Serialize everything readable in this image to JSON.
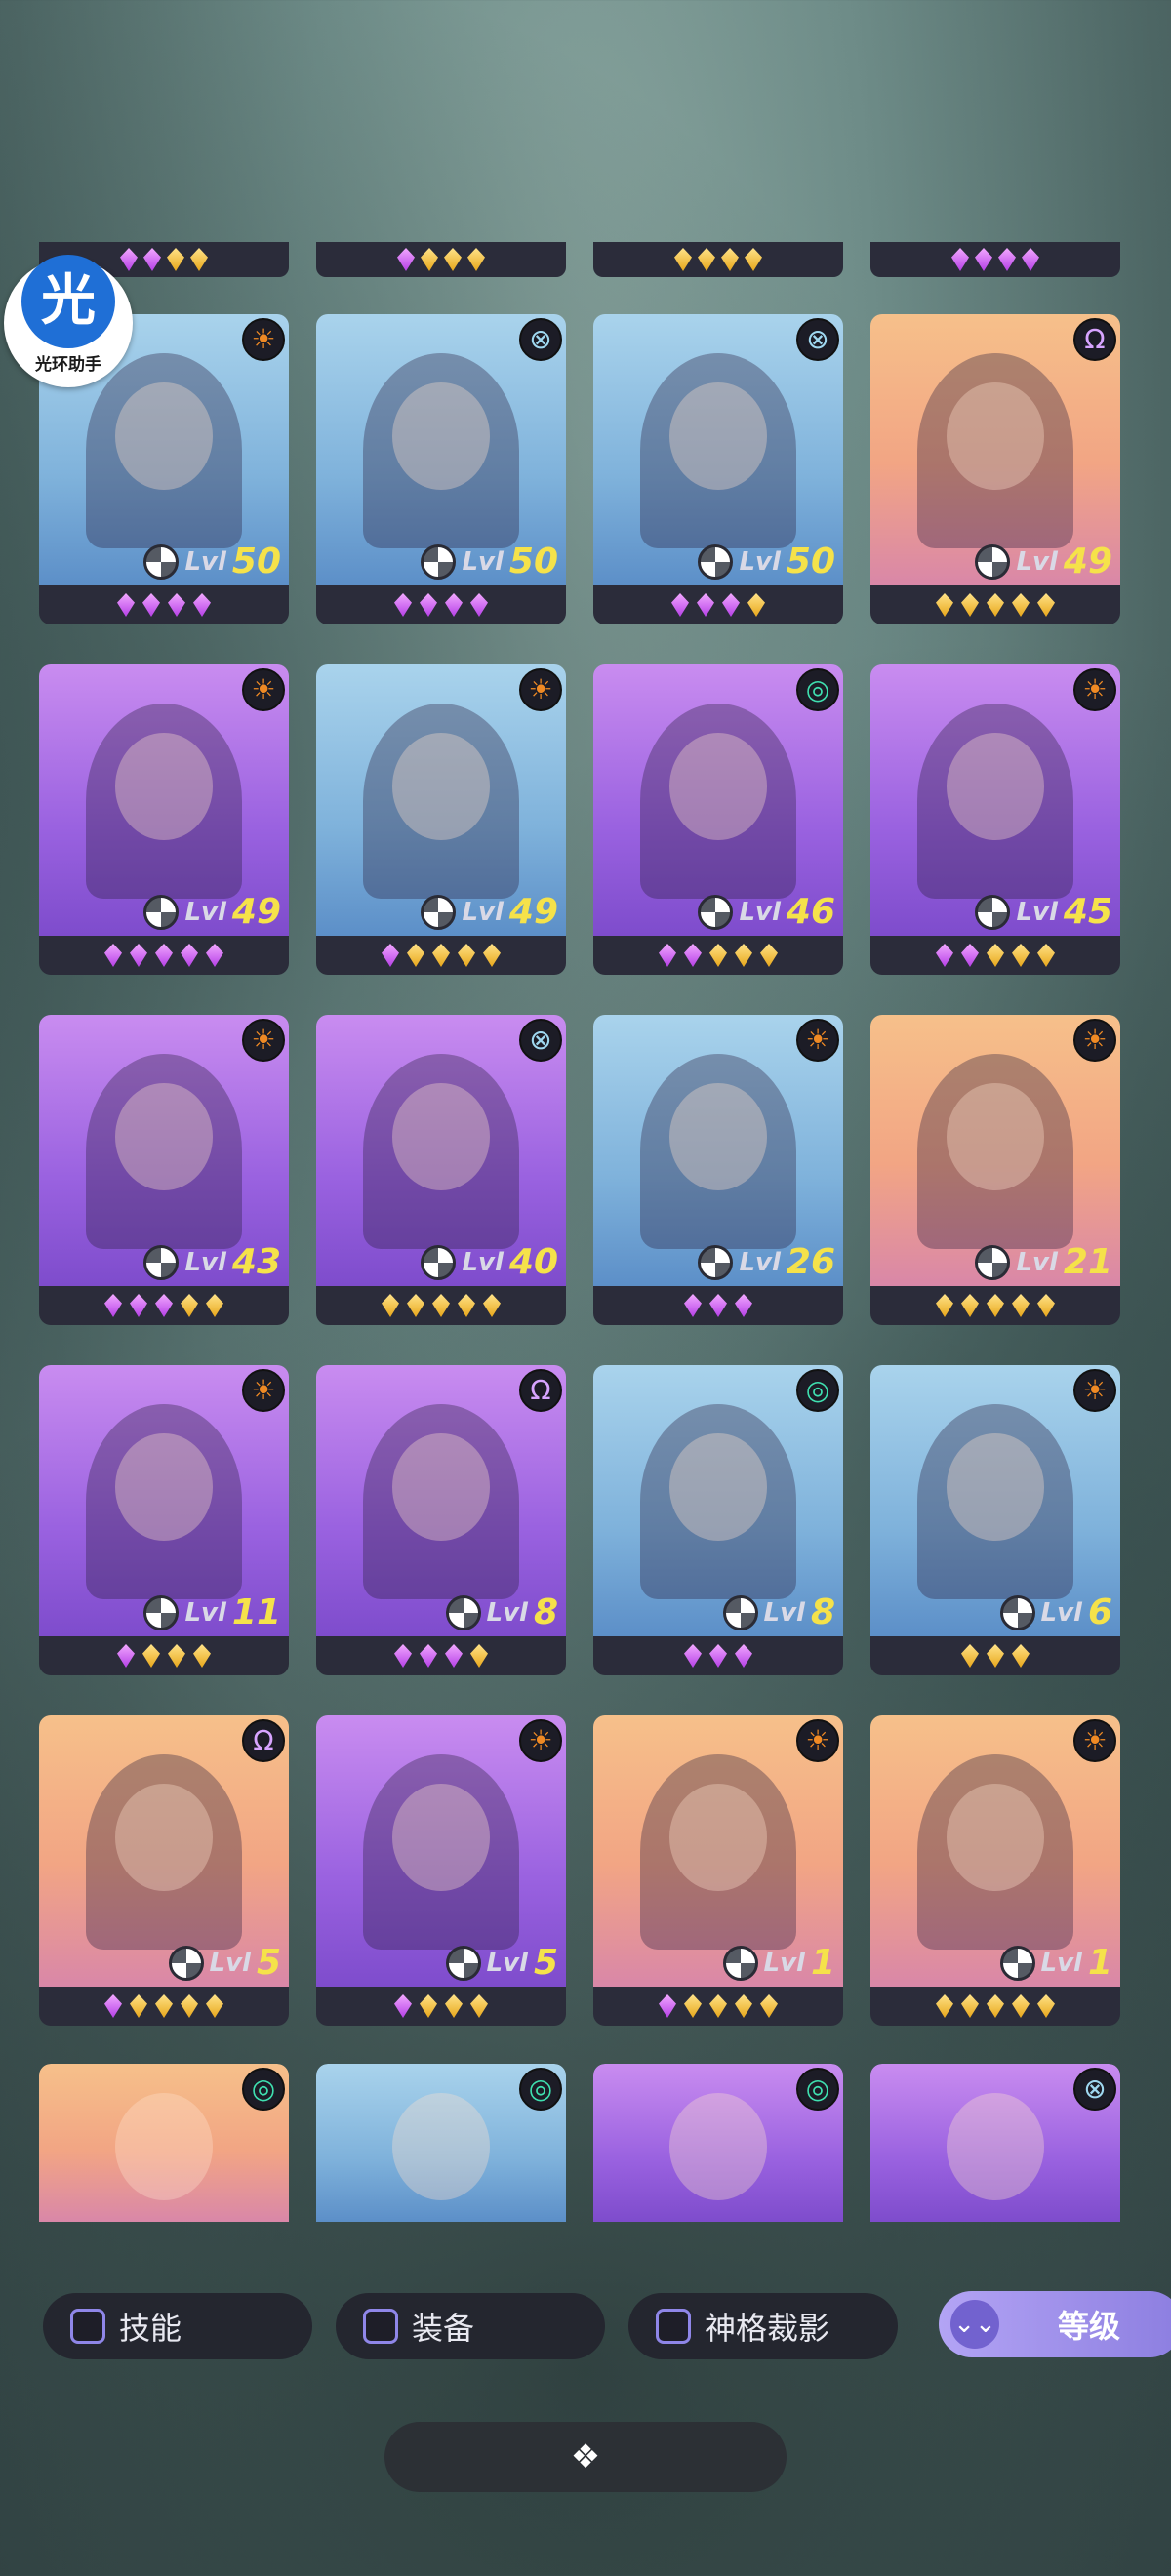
{
  "watermark": {
    "glyph": "光",
    "caption": "光环助手"
  },
  "faction_icons": {
    "sun": "☀",
    "cross": "⊗",
    "omega": "Ω",
    "spiral": "◎"
  },
  "top_partial_gems": [
    [
      "p",
      "p",
      "g",
      "g"
    ],
    [
      "p",
      "g",
      "g",
      "g"
    ],
    [
      "g",
      "g",
      "g",
      "g"
    ],
    [
      "p",
      "p",
      "p",
      "p"
    ]
  ],
  "heroes": [
    {
      "level_label": "Lvl",
      "level": "50",
      "bg": "blue",
      "faction": "sun",
      "gems": [
        "p",
        "p",
        "p",
        "p"
      ]
    },
    {
      "level_label": "Lvl",
      "level": "50",
      "bg": "blue",
      "faction": "cross",
      "gems": [
        "p",
        "p",
        "p",
        "p"
      ]
    },
    {
      "level_label": "Lvl",
      "level": "50",
      "bg": "blue",
      "faction": "cross",
      "gems": [
        "p",
        "p",
        "p",
        "g"
      ]
    },
    {
      "level_label": "Lvl",
      "level": "49",
      "bg": "orange",
      "faction": "omega",
      "gems": [
        "g",
        "g",
        "g",
        "g",
        "g"
      ]
    },
    {
      "level_label": "Lvl",
      "level": "49",
      "bg": "purple",
      "faction": "sun",
      "gems": [
        "p",
        "p",
        "p",
        "p",
        "p"
      ]
    },
    {
      "level_label": "Lvl",
      "level": "49",
      "bg": "blue",
      "faction": "sun",
      "gems": [
        "p",
        "g",
        "g",
        "g",
        "g"
      ]
    },
    {
      "level_label": "Lvl",
      "level": "46",
      "bg": "purple",
      "faction": "spiral",
      "gems": [
        "p",
        "p",
        "g",
        "g",
        "g"
      ]
    },
    {
      "level_label": "Lvl",
      "level": "45",
      "bg": "purple",
      "faction": "sun",
      "gems": [
        "p",
        "p",
        "g",
        "g",
        "g"
      ]
    },
    {
      "level_label": "Lvl",
      "level": "43",
      "bg": "purple",
      "faction": "sun",
      "gems": [
        "p",
        "p",
        "p",
        "g",
        "g"
      ]
    },
    {
      "level_label": "Lvl",
      "level": "40",
      "bg": "purple",
      "faction": "cross",
      "gems": [
        "g",
        "g",
        "g",
        "g",
        "g"
      ]
    },
    {
      "level_label": "Lvl",
      "level": "26",
      "bg": "blue",
      "faction": "sun",
      "gems": [
        "p",
        "p",
        "p"
      ]
    },
    {
      "level_label": "Lvl",
      "level": "21",
      "bg": "orange",
      "faction": "sun",
      "gems": [
        "g",
        "g",
        "g",
        "g",
        "g"
      ]
    },
    {
      "level_label": "Lvl",
      "level": "11",
      "bg": "purple",
      "faction": "sun",
      "gems": [
        "p",
        "g",
        "g",
        "g"
      ]
    },
    {
      "level_label": "Lvl",
      "level": "8",
      "bg": "purple",
      "faction": "omega",
      "gems": [
        "p",
        "p",
        "p",
        "g"
      ]
    },
    {
      "level_label": "Lvl",
      "level": "8",
      "bg": "blue",
      "faction": "spiral",
      "gems": [
        "p",
        "p",
        "p"
      ]
    },
    {
      "level_label": "Lvl",
      "level": "6",
      "bg": "blue",
      "faction": "sun",
      "gems": [
        "g",
        "g",
        "g"
      ]
    },
    {
      "level_label": "Lvl",
      "level": "5",
      "bg": "orange",
      "faction": "omega",
      "gems": [
        "p",
        "g",
        "g",
        "g",
        "g"
      ]
    },
    {
      "level_label": "Lvl",
      "level": "5",
      "bg": "purple",
      "faction": "sun",
      "gems": [
        "p",
        "g",
        "g",
        "g"
      ]
    },
    {
      "level_label": "Lvl",
      "level": "1",
      "bg": "orange",
      "faction": "sun",
      "gems": [
        "p",
        "g",
        "g",
        "g",
        "g"
      ]
    },
    {
      "level_label": "Lvl",
      "level": "1",
      "bg": "orange",
      "faction": "sun",
      "gems": [
        "g",
        "g",
        "g",
        "g",
        "g"
      ]
    }
  ],
  "bottom_partial": [
    {
      "bg": "orange",
      "faction": "spiral"
    },
    {
      "bg": "blue",
      "faction": "spiral"
    },
    {
      "bg": "purple",
      "faction": "spiral"
    },
    {
      "bg": "purple",
      "faction": "cross"
    }
  ],
  "filters": {
    "skill": "技能",
    "equipment": "装备",
    "divinity": "神格裁影",
    "level": "等级",
    "level_icon": "⌄⌄"
  },
  "collapse": {
    "icon": "❖"
  }
}
